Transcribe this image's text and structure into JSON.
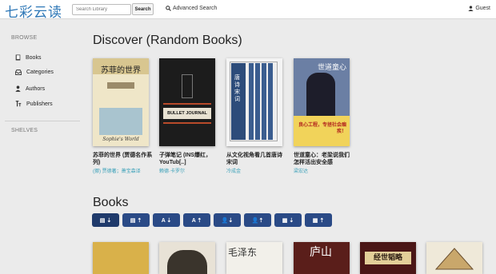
{
  "header": {
    "brand": "七彩云读",
    "search_placeholder": "Search Library",
    "search_button": "Search",
    "advanced_search": "Advanced Search",
    "user_label": "Guest"
  },
  "sidebar": {
    "browse_heading": "BROWSE",
    "items": [
      {
        "label": "Books",
        "icon": "book-icon"
      },
      {
        "label": "Categories",
        "icon": "inbox-icon"
      },
      {
        "label": "Authors",
        "icon": "user-icon"
      },
      {
        "label": "Publishers",
        "icon": "text-size-icon"
      }
    ],
    "shelves_heading": "SHELVES"
  },
  "discover": {
    "title": "Discover (Random Books)",
    "books": [
      {
        "title": "苏菲的世界 (贾德名作系列)",
        "author": "(挪) 贾德著；萧宝森译",
        "cover_text": "苏菲的世界",
        "cover_caption": "Sophie's World"
      },
      {
        "title": "子弹笔记 (INS爆红，YouTub[..]",
        "author": "赖德·卡罗尔",
        "cover_text": "BULLET JOURNAL"
      },
      {
        "title": "从文化视角看几首唐诗宋词",
        "author": "冷成金",
        "cover_text": "唐诗宋词"
      },
      {
        "title": "世道童心：老梁说我们怎样活出安全感",
        "author": "梁宏达",
        "cover_text": "世道童心",
        "cover_caption": "良心工程，专拯社会痼疾！"
      }
    ]
  },
  "books_section": {
    "title": "Books",
    "sort_buttons": [
      {
        "label": "▤ ⇣",
        "icon": "sort-date-desc-icon"
      },
      {
        "label": "▤ ⇡",
        "icon": "sort-date-asc-icon"
      },
      {
        "label": "A ⇣",
        "icon": "sort-title-desc-icon"
      },
      {
        "label": "A ⇡",
        "icon": "sort-title-asc-icon"
      },
      {
        "label": "👤⇣",
        "icon": "sort-author-desc-icon"
      },
      {
        "label": "👤⇡",
        "icon": "sort-author-asc-icon"
      },
      {
        "label": "▦ ⇣",
        "icon": "sort-pubdate-desc-icon"
      },
      {
        "label": "▦ ⇡",
        "icon": "sort-pubdate-asc-icon"
      }
    ],
    "bottom_cover_texts": [
      "",
      "",
      "毛泽东",
      "庐山",
      "经世韬略",
      ""
    ]
  },
  "colors": {
    "brand": "#2f78b7",
    "sort_button": "#2a4a86",
    "author_link": "#3aa0b8"
  }
}
